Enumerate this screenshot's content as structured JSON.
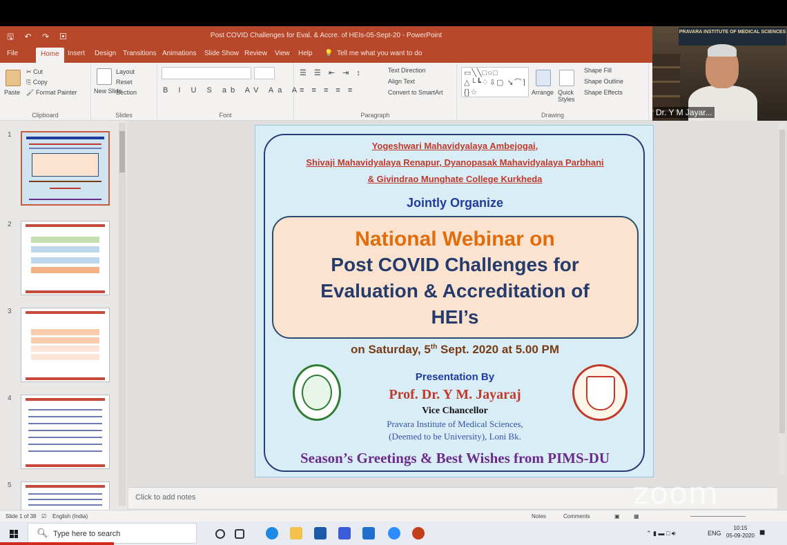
{
  "app": {
    "window_title": "Post COVID Challenges for Eval. & Accre. of HEIs-05-Sept-20 - PowerPoint",
    "tabs": [
      "File",
      "Home",
      "Insert",
      "Design",
      "Transitions",
      "Animations",
      "Slide Show",
      "Review",
      "View",
      "Help"
    ],
    "tell_me": "Tell me what you want to do"
  },
  "ribbon": {
    "clipboard": {
      "label": "Clipboard",
      "paste": "Paste",
      "cut": "Cut",
      "copy": "Copy",
      "format_painter": "Format Painter"
    },
    "slides": {
      "label": "Slides",
      "new_slide": "New Slide",
      "layout": "Layout",
      "reset": "Reset",
      "section": "Section"
    },
    "font": {
      "label": "Font"
    },
    "paragraph": {
      "label": "Paragraph",
      "text_direction": "Text Direction",
      "align_text": "Align Text",
      "smartart": "Convert to SmartArt"
    },
    "drawing": {
      "label": "Drawing",
      "arrange": "Arrange",
      "quick_styles": "Quick Styles",
      "shape_fill": "Shape Fill",
      "shape_outline": "Shape Outline",
      "shape_effects": "Shape Effects"
    }
  },
  "video": {
    "participant_name": "Dr. Y M Jayar...",
    "banner": "PRAVARA INSTITUTE OF MEDICAL SCIENCES"
  },
  "thumbnails": {
    "numbers": [
      "1",
      "2",
      "3",
      "4",
      "5"
    ]
  },
  "slide": {
    "org_line1": "Yogeshwari Mahavidyalaya Ambejogai,",
    "org_line2": "Shivaji Mahavidyalaya Renapur, Dyanopasak Mahavidyalaya Parbhani",
    "org_line3": "& Givindrao Munghate College Kurkheda",
    "jointly": "Jointly Organize",
    "webinar": "National Webinar on",
    "title_line1": "Post COVID Challenges for",
    "title_line2": "Evaluation & Accreditation of",
    "title_line3": "HEI’s",
    "date_pre": "on Saturday, 5",
    "date_sup": "th",
    "date_post": " Sept. 2020 at 5.00 PM",
    "presentation_by": "Presentation By",
    "presenter": "Prof.  Dr. Y M. Jayaraj",
    "designation": "Vice Chancellor",
    "institute_line1": "Pravara Institute of Medical Sciences,",
    "institute_line2": "(Deemed to be University), Loni Bk.",
    "greetings": "Season’s Greetings & Best Wishes from PIMS-DU"
  },
  "notes": {
    "placeholder": "Click to add notes"
  },
  "statusbar": {
    "slide_info": "Slide 1 of 38",
    "language": "English (India)",
    "notes": "Notes",
    "comments": "Comments"
  },
  "taskbar": {
    "search_placeholder": "Type here to search",
    "lang": "ENG",
    "time": "10:15",
    "date": "05-09-2020"
  },
  "watermark": "zoom",
  "colors": {
    "ppt_accent": "#b7472a",
    "slide_bg": "#d9edf6",
    "title_blue": "#243b6b",
    "webinar_orange": "#e26b0a"
  }
}
